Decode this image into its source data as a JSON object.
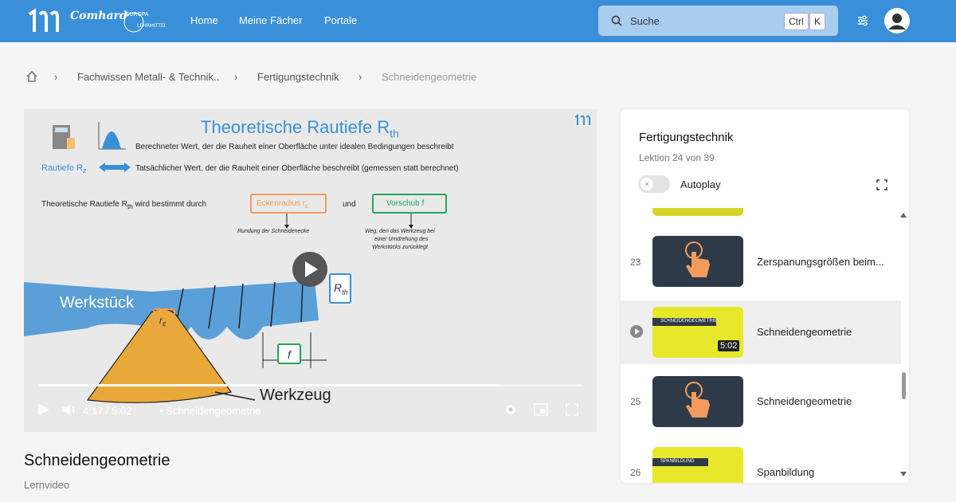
{
  "header": {
    "brand": "Comhard",
    "brand_sub": "EUROPA LEHRMITTEL",
    "nav": [
      "Home",
      "Meine Fächer",
      "Portale"
    ],
    "search_placeholder": "Suche",
    "kbd": [
      "Ctrl",
      "K"
    ],
    "accent": "#3a8fd9"
  },
  "breadcrumb": [
    "Fachwissen Metall- & Technik..",
    "Fertigungstechnik",
    "Schneidengeometrie"
  ],
  "video": {
    "title": "Theoretische Rautiefe R",
    "title_sub": "th",
    "line1": "Berechneter Wert, der die Rauheit einer Oberfläche unter idealen Bedingungen beschreibt",
    "rautiefe_label": "Rautiefe R",
    "rautiefe_sub": "z",
    "line2": "Tatsächlicher Wert, der die Rauheit einer Oberfläche beschreibt  (gemessen statt berechnet)",
    "line3a": "Theoretische Rautiefe R",
    "line3b": "wird bestimmt durch",
    "line3_sub": "th",
    "eckenradius": "Eckenradius r",
    "eckenradius_sub": "ε",
    "und": "und",
    "vorschub": "Vorschub f",
    "rundung": "Rundung der Schneidenecke",
    "weg": [
      "Weg, den das Werkzeug bei",
      "einer Umdrehung des",
      "Werkstücks zurücklegt"
    ],
    "werkstueck": "Werkstück",
    "werkzeug": "Werkzeug",
    "rth_label": "R",
    "rth_sub": "th",
    "f_label": "f",
    "re_label": "r",
    "re_sub": "ε",
    "time": "4:17 / 5:02",
    "chapter": "• Schneidengeometrie",
    "progress": 0.85
  },
  "sidebar": {
    "title": "Fertigungstechnik",
    "subtitle": "Lektion 24 von 39",
    "autoplay": "Autoplay",
    "items": [
      {
        "num": "23",
        "title": "Zerspanungsgrößen beim...",
        "thumb": "dark"
      },
      {
        "num": "",
        "title": "Schneidengeometrie",
        "thumb": "yellow",
        "thumb_text": "SCHNEIDENGEOMETRIE",
        "duration": "5:02",
        "active": true
      },
      {
        "num": "25",
        "title": "Schneidengeometrie",
        "thumb": "dark"
      },
      {
        "num": "26",
        "title": "Spanbildung",
        "thumb": "yellow",
        "thumb_text": "SPANBILDUNG"
      }
    ]
  },
  "page": {
    "title": "Schneidengeometrie",
    "subtitle": "Lernvideo"
  }
}
